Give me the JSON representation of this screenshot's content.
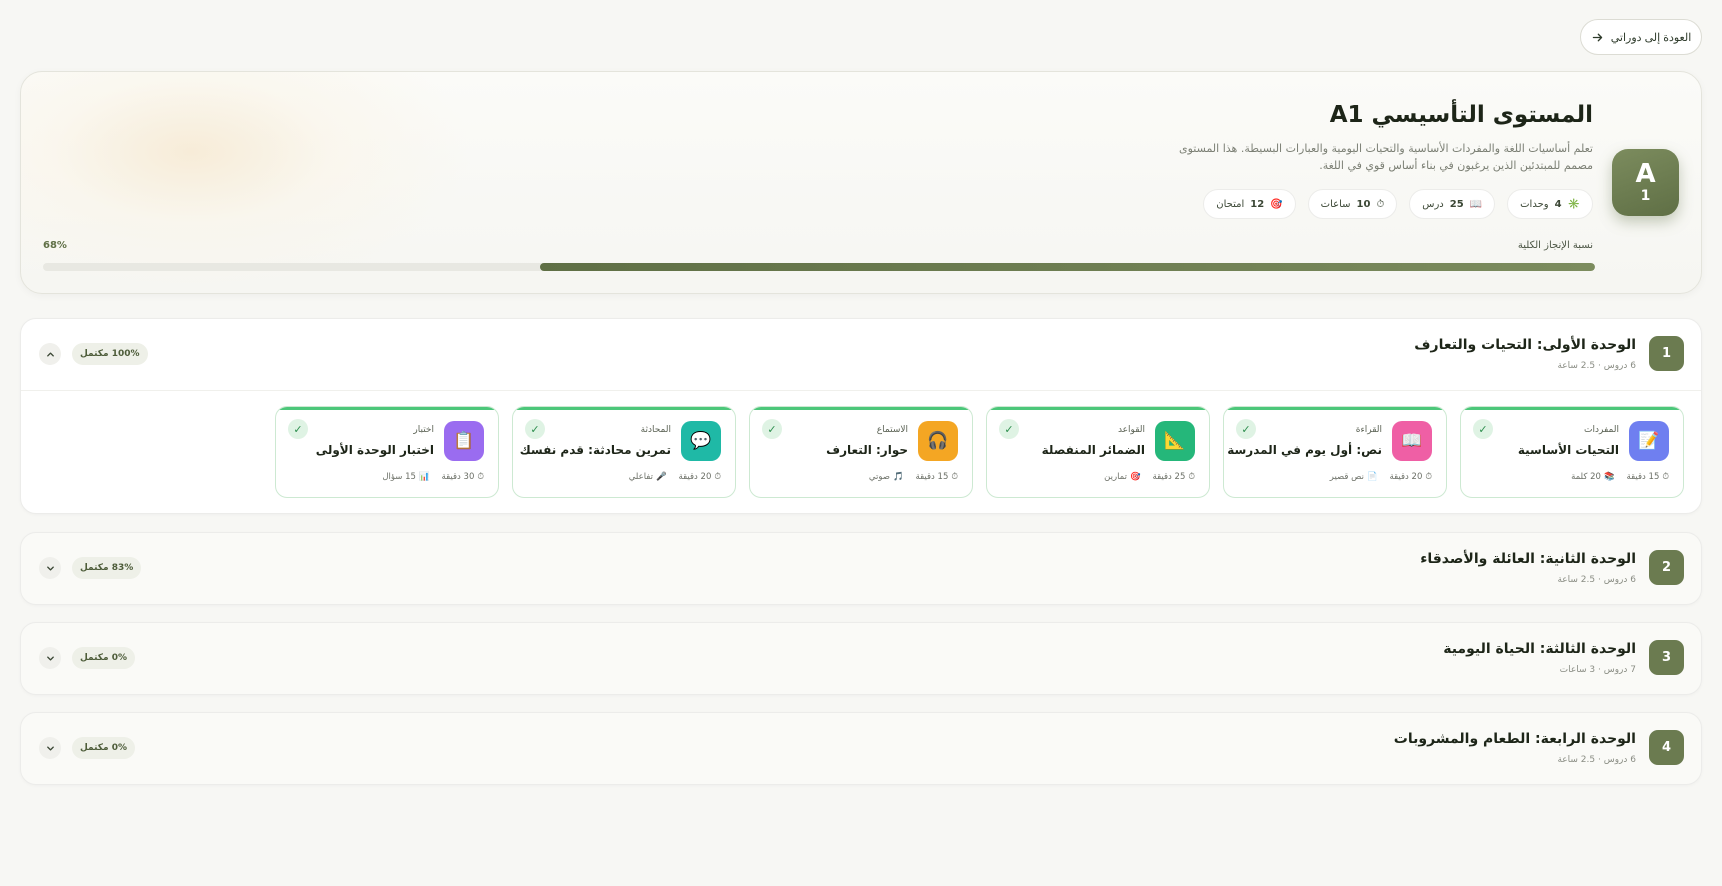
{
  "back_button": {
    "label": "العودة إلى دوراتي"
  },
  "level": {
    "badge_letter": "A",
    "badge_number": "1",
    "title": "المستوى التأسيسي A1",
    "description": "تعلم أساسيات اللغة والمفردات الأساسية والتحيات اليومية والعبارات البسيطة. هذا المستوى مصمم للمبتدئين الذين يرغبون في بناء أساس قوي في اللغة.",
    "stats": [
      {
        "icon": "✳️",
        "value": "4",
        "label": "وحدات"
      },
      {
        "icon": "📖",
        "value": "25",
        "label": "درس"
      },
      {
        "icon": "⏱",
        "value": "10",
        "label": "ساعات"
      },
      {
        "icon": "🎯",
        "value": "12",
        "label": "امتحان"
      }
    ],
    "progress_label": "نسبة الإنجاز الكلية",
    "progress_text": "68%",
    "progress_value": 68
  },
  "units": [
    {
      "number": "1",
      "title": "الوحدة الأولى: التحيات والتعارف",
      "meta": "6 دروس · 2.5 ساعة",
      "completion": "100% مكتمل",
      "lessons": [
        {
          "category": "المفردات",
          "title": "التحيات الأساسية",
          "icon": "📝",
          "color": "#6f7ff0",
          "duration": "15 دقيقة",
          "extra": "20 كلمة",
          "extra_icon": "📚"
        },
        {
          "category": "القراءة",
          "title": "نص: أول يوم في المدرسة",
          "icon": "📖",
          "color": "#ef5fa5",
          "duration": "20 دقيقة",
          "extra": "نص قصير",
          "extra_icon": "📄"
        },
        {
          "category": "القواعد",
          "title": "الضمائر المنفصلة",
          "icon": "📐",
          "color": "#25b77a",
          "duration": "25 دقيقة",
          "extra": "تمارين",
          "extra_icon": "🎯"
        },
        {
          "category": "الاستماع",
          "title": "حوار: التعارف",
          "icon": "🎧",
          "color": "#f4a623",
          "duration": "15 دقيقة",
          "extra": "صوتي",
          "extra_icon": "🎵"
        },
        {
          "category": "المحادثة",
          "title": "تمرين محادثة: قدم نفسك",
          "icon": "💬",
          "color": "#1fb9a6",
          "duration": "20 دقيقة",
          "extra": "تفاعلي",
          "extra_icon": "🎤"
        },
        {
          "category": "اختبار",
          "title": "اختبار الوحدة الأولى",
          "icon": "📋",
          "color": "#9a6cf0",
          "duration": "30 دقيقة",
          "extra": "15 سؤال",
          "extra_icon": "📊"
        }
      ]
    },
    {
      "number": "2",
      "title": "الوحدة الثانية: العائلة والأصدقاء",
      "meta": "6 دروس · 2.5 ساعة",
      "completion": "83% مكتمل"
    },
    {
      "number": "3",
      "title": "الوحدة الثالثة: الحياة اليومية",
      "meta": "7 دروس · 3 ساعات",
      "completion": "0% مكتمل"
    },
    {
      "number": "4",
      "title": "الوحدة الرابعة: الطعام والمشروبات",
      "meta": "6 دروس · 2.5 ساعة",
      "completion": "0% مكتمل"
    }
  ],
  "lesson_check": "✓",
  "duration_icon": "⏱"
}
